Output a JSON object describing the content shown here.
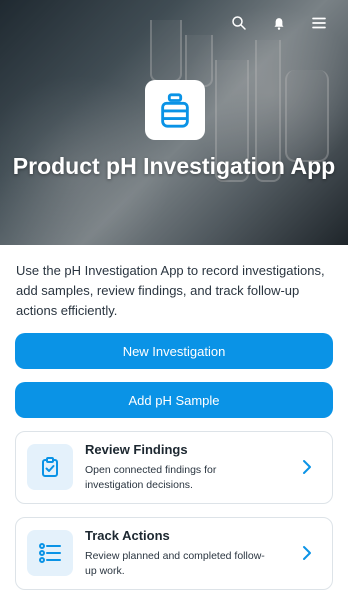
{
  "header": {
    "title": "Product pH Investigation App",
    "icons": [
      "search-icon",
      "bell-icon",
      "menu-icon"
    ]
  },
  "intro": "Use the pH Investigation App to record investigations, add samples, review findings, and track follow-up actions efficiently.",
  "buttons": {
    "new_investigation": "New Investigation",
    "add_sample": "Add pH Sample"
  },
  "cards": [
    {
      "title": "Review Findings",
      "description": "Open connected findings for investigation decisions.",
      "icon": "clipboard-check-icon"
    },
    {
      "title": "Track Actions",
      "description": "Review planned and completed follow-up work.",
      "icon": "checklist-icon"
    }
  ],
  "colors": {
    "accent": "#0a93e6",
    "icon_bg": "#e4f1fb",
    "card_border": "#dde3e8"
  }
}
